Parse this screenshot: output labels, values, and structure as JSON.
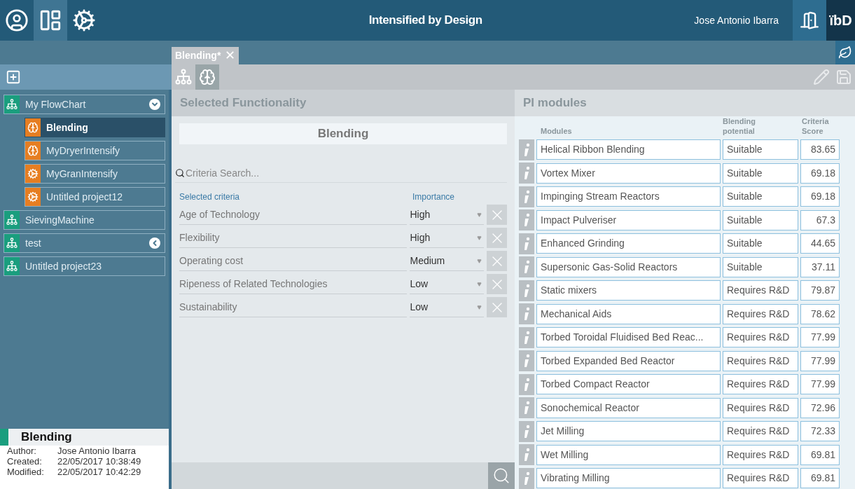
{
  "header": {
    "title": "Intensified by Design",
    "user": "Jose Antonio Ibarra",
    "logo": "ïbD",
    "nav": [
      {
        "kind": "user",
        "selected": false
      },
      {
        "kind": "board",
        "selected": true
      },
      {
        "kind": "gears",
        "selected": false
      }
    ]
  },
  "tabs": [
    {
      "label": "Blending*",
      "selected": true,
      "close": "✕"
    }
  ],
  "views": [
    {
      "kind": "flowchart",
      "selected": false
    },
    {
      "kind": "head",
      "selected": true
    }
  ],
  "sidebar": {
    "items": [
      {
        "label": "My FlowChart",
        "kind": "flowchart",
        "expanded": true,
        "selected": false,
        "children": [
          {
            "label": "Blending",
            "kind": "head",
            "selected": true
          },
          {
            "label": "MyDryerIntensify",
            "kind": "head",
            "selected": false
          },
          {
            "label": "MyGranIntensify",
            "kind": "gear",
            "selected": false
          },
          {
            "label": "Untitled project12",
            "kind": "gear",
            "selected": false
          }
        ]
      },
      {
        "label": "SievingMachine",
        "kind": "flowchart",
        "selected": false
      },
      {
        "label": "test",
        "kind": "flowchart",
        "expanded": false,
        "selected": false
      },
      {
        "label": "Untitled project23",
        "kind": "flowchart",
        "selected": false
      }
    ]
  },
  "info": {
    "title": "Blending",
    "fields": [
      {
        "label": "Author:",
        "value": "Jose Antonio Ibarra"
      },
      {
        "label": "Created:",
        "value": "22/05/2017 10:38:49"
      },
      {
        "label": "Modified:",
        "value": "22/05/2017 10:42:29"
      }
    ]
  },
  "functionality": {
    "heading": "Selected Functionality",
    "name": "Blending",
    "search": {
      "placeholder": "Criteria Search..."
    },
    "columns": [
      "Selected criteria",
      "Importance"
    ],
    "criteria": [
      {
        "name": "Age of Technology",
        "importance": "High"
      },
      {
        "name": "Flexibility",
        "importance": "High"
      },
      {
        "name": "Operating cost",
        "importance": "Medium"
      },
      {
        "name": "Ripeness of Related Technologies",
        "importance": "Low"
      },
      {
        "name": "Sustainability",
        "importance": "Low"
      }
    ]
  },
  "modules": {
    "heading": "PI modules",
    "columns": [
      "Modules",
      "Blending potential",
      "Criteria Score"
    ],
    "rows": [
      [
        "Helical Ribbon Blending",
        "Suitable",
        "83.65"
      ],
      [
        "Vortex Mixer",
        "Suitable",
        "69.18"
      ],
      [
        "Impinging Stream Reactors",
        "Suitable",
        "69.18"
      ],
      [
        "Impact Pulveriser",
        "Suitable",
        "67.3"
      ],
      [
        "Enhanced Grinding",
        "Suitable",
        "44.65"
      ],
      [
        "Supersonic Gas-Solid Reactors",
        "Suitable",
        "37.11"
      ],
      [
        "Static mixers",
        "Requires R&D",
        "79.87"
      ],
      [
        "Mechanical Aids",
        "Requires R&D",
        "78.62"
      ],
      [
        "Torbed Toroidal Fluidised Bed Reac...",
        "Requires R&D",
        "77.99"
      ],
      [
        "Torbed Expanded Bed Reactor",
        "Requires R&D",
        "77.99"
      ],
      [
        "Torbed Compact Reactor",
        "Requires R&D",
        "77.99"
      ],
      [
        "Sonochemical Reactor",
        "Requires R&D",
        "72.96"
      ],
      [
        "Jet Milling",
        "Requires R&D",
        "72.33"
      ],
      [
        "Wet Milling",
        "Requires R&D",
        "69.81"
      ],
      [
        "Vibrating Milling",
        "Requires R&D",
        "69.81"
      ]
    ]
  }
}
